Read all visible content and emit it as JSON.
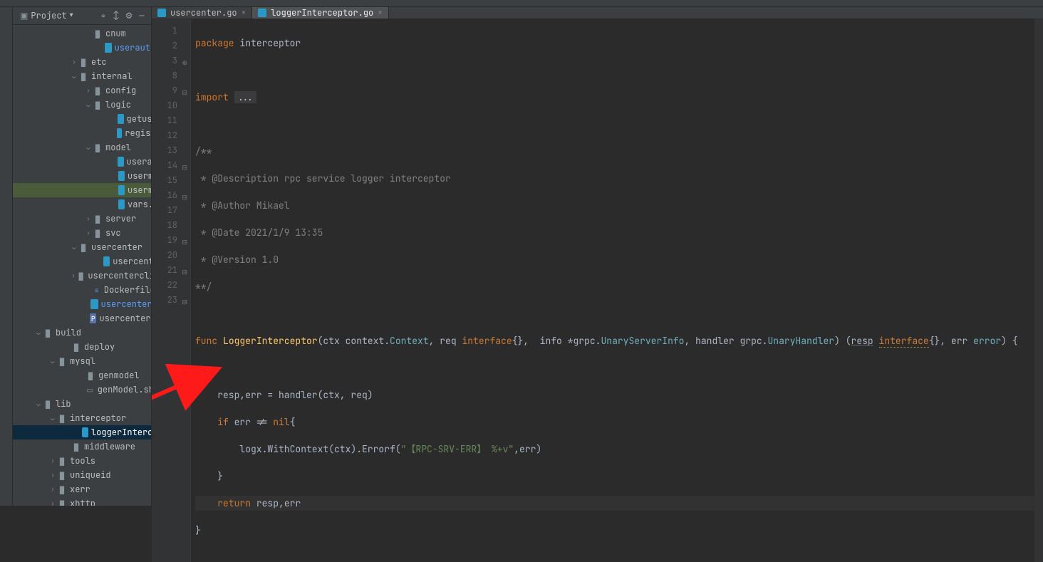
{
  "sidebar": {
    "header_label": "Project",
    "items": [
      {
        "indent": 100,
        "arrow": "",
        "icon": "folder",
        "label": "cnum"
      },
      {
        "indent": 120,
        "arrow": "",
        "icon": "go",
        "label": "userauthmo",
        "blue": true
      },
      {
        "indent": 80,
        "arrow": ">",
        "icon": "folder",
        "label": "etc"
      },
      {
        "indent": 80,
        "arrow": "v",
        "icon": "folder",
        "label": "internal"
      },
      {
        "indent": 100,
        "arrow": ">",
        "icon": "folder",
        "label": "config"
      },
      {
        "indent": 100,
        "arrow": "v",
        "icon": "folder",
        "label": "logic"
      },
      {
        "indent": 140,
        "arrow": "",
        "icon": "go",
        "label": "getuserb"
      },
      {
        "indent": 140,
        "arrow": "",
        "icon": "go",
        "label": "registerlo"
      },
      {
        "indent": 100,
        "arrow": "v",
        "icon": "folder",
        "label": "model"
      },
      {
        "indent": 140,
        "arrow": "",
        "icon": "go",
        "label": "userauth"
      },
      {
        "indent": 140,
        "arrow": "",
        "icon": "go",
        "label": "usermod"
      },
      {
        "indent": 140,
        "arrow": "",
        "icon": "go",
        "label": "usermod",
        "selgreen": true
      },
      {
        "indent": 140,
        "arrow": "",
        "icon": "go",
        "label": "vars.go"
      },
      {
        "indent": 100,
        "arrow": ">",
        "icon": "folder",
        "label": "server"
      },
      {
        "indent": 100,
        "arrow": ">",
        "icon": "folder",
        "label": "svc"
      },
      {
        "indent": 80,
        "arrow": "v",
        "icon": "folder",
        "label": "usercenter"
      },
      {
        "indent": 120,
        "arrow": "",
        "icon": "go",
        "label": "usercenter.p"
      },
      {
        "indent": 80,
        "arrow": ">",
        "icon": "folder",
        "label": "usercenterclien"
      },
      {
        "indent": 100,
        "arrow": "",
        "icon": "docker",
        "label": "Dockerfile"
      },
      {
        "indent": 100,
        "arrow": "",
        "icon": "go",
        "label": "usercenter.go",
        "blue": true
      },
      {
        "indent": 100,
        "arrow": "",
        "icon": "proto",
        "label": "usercenter.prot"
      },
      {
        "indent": 30,
        "arrow": "v",
        "icon": "folder",
        "label": "build"
      },
      {
        "indent": 70,
        "arrow": "",
        "icon": "folder",
        "label": "deploy"
      },
      {
        "indent": 50,
        "arrow": "v",
        "icon": "folder",
        "label": "mysql"
      },
      {
        "indent": 90,
        "arrow": "",
        "icon": "folder",
        "label": "genmodel"
      },
      {
        "indent": 90,
        "arrow": "",
        "icon": "file",
        "label": "genModel.sh"
      },
      {
        "indent": 30,
        "arrow": "v",
        "icon": "folder",
        "label": "lib"
      },
      {
        "indent": 50,
        "arrow": "v",
        "icon": "folder",
        "label": "interceptor"
      },
      {
        "indent": 90,
        "arrow": "",
        "icon": "go",
        "label": "loggerInterceptor.g",
        "seldark": true
      },
      {
        "indent": 70,
        "arrow": "",
        "icon": "folder",
        "label": "middleware"
      },
      {
        "indent": 50,
        "arrow": ">",
        "icon": "folder",
        "label": "tools"
      },
      {
        "indent": 50,
        "arrow": ">",
        "icon": "folder",
        "label": "uniqueid"
      },
      {
        "indent": 50,
        "arrow": ">",
        "icon": "folder",
        "label": "xerr"
      },
      {
        "indent": 50,
        "arrow": ">",
        "icon": "folder",
        "label": "xhttp"
      }
    ]
  },
  "tabs": [
    {
      "label": "usercenter.go",
      "active": false
    },
    {
      "label": "loggerInterceptor.go",
      "active": true
    }
  ],
  "tab0": "usercenter.go",
  "tab1": "loggerInterceptor.go",
  "gutter": [
    "1",
    "2",
    "3",
    "8",
    "9",
    "10",
    "11",
    "12",
    "13",
    "14",
    "15",
    "16",
    "17",
    "18",
    "19",
    "20",
    "21",
    "22",
    "23"
  ],
  "code": {
    "l1_package": "package",
    "l1_name": "interceptor",
    "l3_import": "import",
    "l3_dots": "...",
    "c1": "/**",
    "c2": " * @Description rpc service logger interceptor",
    "c3": " * @Author Mikael",
    "c4": " * @Date 2021/1/9 13:35",
    "c5": " * @Version 1.0",
    "c6": "**/",
    "func_kw": "func",
    "func_name": "LoggerInterceptor",
    "sig_a": "(ctx context.",
    "sig_ctx": "Context",
    "sig_b": ", req ",
    "sig_iface": "interface",
    "sig_c": "{},  info *grpc.",
    "sig_usi": "UnaryServerInfo",
    "sig_d": ", handler grpc.",
    "sig_uh": "UnaryHandler",
    "sig_e": ") (",
    "sig_resp": "resp",
    "sig_iface2": "interface",
    "sig_f": "{}, err ",
    "sig_err": "error",
    "sig_g": ") {",
    "l18": "    resp,err = handler(ctx, req)",
    "l19_if": "if",
    "l19_rest": " err != ",
    "l19_nil": "nil",
    "l19_brace": "{",
    "l20_a": "        logx.WithContext(ctx).Errorf(",
    "l20_str": "\"【RPC-SRV-ERR】 %+v\"",
    "l20_b": ",err)",
    "l21": "    }",
    "l22_ret": "return",
    "l22_rest": " resp,err",
    "l23": "}"
  },
  "chart_data": null
}
